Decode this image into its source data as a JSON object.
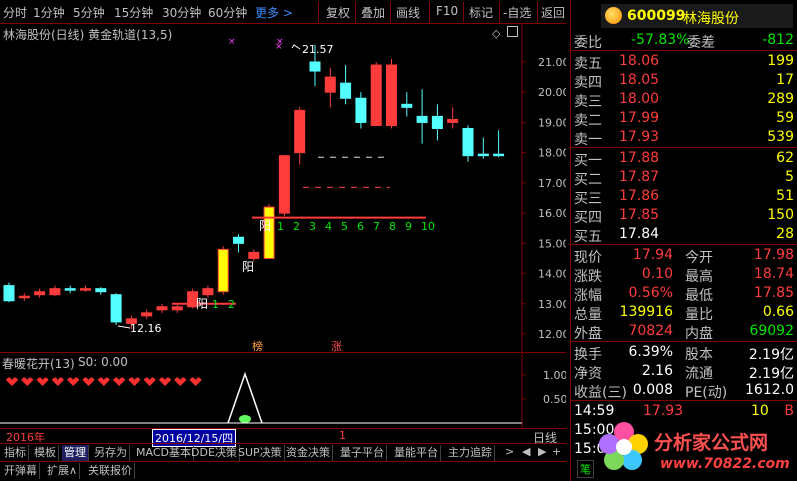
{
  "toolbar": {
    "items": [
      "分时",
      "1分钟",
      "5分钟",
      "15分钟",
      "30分钟",
      "60分钟"
    ],
    "more": "更多 >",
    "buttons": [
      "复权",
      "叠加",
      "画线",
      "F10",
      "标记",
      "-自选",
      "返回"
    ]
  },
  "chart": {
    "title": "林海股份(日线) 黄金轨道(13,5)",
    "price_ticks": [
      "21.00",
      "20.00",
      "19.00",
      "18.00",
      "17.00",
      "16.00",
      "15.00",
      "14.00",
      "13.00",
      "12.00"
    ],
    "high_label": "21.57",
    "low_label": "12.16",
    "yang_labels": [
      "阳",
      "阳",
      "阳"
    ],
    "counter_1": [
      "1",
      "2"
    ],
    "counter_2": [
      "1",
      "2",
      "3",
      "4",
      "5",
      "6",
      "7",
      "8",
      "9",
      "10"
    ],
    "markers": [
      "榜",
      "涨"
    ],
    "candles": [
      {
        "o": 13.6,
        "c": 13.1,
        "h": 13.7,
        "l": 13.05,
        "up": false
      },
      {
        "o": 13.2,
        "c": 13.25,
        "h": 13.35,
        "l": 13.1,
        "up": true
      },
      {
        "o": 13.3,
        "c": 13.4,
        "h": 13.5,
        "l": 13.2,
        "up": true
      },
      {
        "o": 13.3,
        "c": 13.5,
        "h": 13.6,
        "l": 13.25,
        "up": true
      },
      {
        "o": 13.5,
        "c": 13.45,
        "h": 13.6,
        "l": 13.35,
        "up": false
      },
      {
        "o": 13.5,
        "c": 13.5,
        "h": 13.6,
        "l": 13.4,
        "up": true
      },
      {
        "o": 13.5,
        "c": 13.4,
        "h": 13.55,
        "l": 13.3,
        "up": false
      },
      {
        "o": 13.3,
        "c": 12.4,
        "h": 13.35,
        "l": 12.3,
        "up": false
      },
      {
        "o": 12.35,
        "c": 12.5,
        "h": 12.6,
        "l": 12.16,
        "up": true
      },
      {
        "o": 12.6,
        "c": 12.7,
        "h": 12.8,
        "l": 12.5,
        "up": true
      },
      {
        "o": 12.8,
        "c": 12.9,
        "h": 13.0,
        "l": 12.7,
        "up": true
      },
      {
        "o": 12.8,
        "c": 12.9,
        "h": 13.0,
        "l": 12.7,
        "up": true
      },
      {
        "o": 12.9,
        "c": 13.4,
        "h": 13.5,
        "l": 12.85,
        "up": true
      },
      {
        "o": 13.3,
        "c": 13.5,
        "h": 13.6,
        "l": 13.2,
        "up": true
      },
      {
        "o": 13.4,
        "c": 14.8,
        "h": 14.9,
        "l": 13.3,
        "up": true,
        "yellow": true
      },
      {
        "o": 15.0,
        "c": 15.2,
        "h": 15.3,
        "l": 14.7,
        "up": false
      },
      {
        "o": 14.5,
        "c": 14.7,
        "h": 14.8,
        "l": 14.4,
        "up": true
      },
      {
        "o": 14.5,
        "c": 16.2,
        "h": 16.3,
        "l": 14.5,
        "up": true,
        "yellow": true
      },
      {
        "o": 16.0,
        "c": 17.9,
        "h": 17.9,
        "l": 15.9,
        "up": true
      },
      {
        "o": 18.0,
        "c": 19.4,
        "h": 19.5,
        "l": 17.6,
        "up": true
      },
      {
        "o": 20.7,
        "c": 21.0,
        "h": 21.57,
        "l": 20.2,
        "up": false
      },
      {
        "o": 20.0,
        "c": 20.5,
        "h": 20.8,
        "l": 19.5,
        "up": true
      },
      {
        "o": 20.3,
        "c": 19.8,
        "h": 20.9,
        "l": 19.6,
        "up": false
      },
      {
        "o": 19.0,
        "c": 19.8,
        "h": 20.0,
        "l": 18.8,
        "up": false
      },
      {
        "o": 18.9,
        "c": 20.9,
        "h": 21.0,
        "l": 18.9,
        "up": true
      },
      {
        "o": 20.9,
        "c": 18.9,
        "h": 21.1,
        "l": 18.8,
        "up": true
      },
      {
        "o": 19.5,
        "c": 19.6,
        "h": 20.0,
        "l": 19.2,
        "up": false
      },
      {
        "o": 19.2,
        "c": 19.0,
        "h": 20.1,
        "l": 18.3,
        "up": false
      },
      {
        "o": 18.8,
        "c": 19.2,
        "h": 19.6,
        "l": 18.4,
        "up": false
      },
      {
        "o": 19.0,
        "c": 19.1,
        "h": 19.5,
        "l": 18.8,
        "up": true
      },
      {
        "o": 18.8,
        "c": 17.9,
        "h": 18.9,
        "l": 17.7,
        "up": false
      },
      {
        "o": 17.9,
        "c": 17.95,
        "h": 18.5,
        "l": 17.8,
        "up": false
      },
      {
        "o": 17.95,
        "c": 17.93,
        "h": 18.74,
        "l": 17.85,
        "up": false
      }
    ]
  },
  "indicator": {
    "title": "春暖花开(13)",
    "s0": "S0: 0.00",
    "ticks": [
      "1.00",
      "0.50"
    ]
  },
  "datebar": {
    "year": "2016年",
    "date": "2016/12/15/四",
    "one": "1",
    "period": "日线"
  },
  "tabs1": [
    "指标",
    "模板",
    "管理",
    "另存为",
    "MACD基本",
    "DDE决策",
    "SUP决策",
    "资金决策",
    "量子平台",
    "量能平台",
    "主力追踪"
  ],
  "tabs2": [
    "开弹幕",
    "扩展∧",
    "关联报价"
  ],
  "quote": {
    "code": "600099",
    "name": "林海股份",
    "weibi_label": "委比",
    "weibi": "-57.83%",
    "weicha_label": "委差",
    "weicha": "-812",
    "sell": [
      {
        "label": "卖五",
        "price": "18.06",
        "vol": "199"
      },
      {
        "label": "卖四",
        "price": "18.05",
        "vol": "17"
      },
      {
        "label": "卖三",
        "price": "18.00",
        "vol": "289"
      },
      {
        "label": "卖二",
        "price": "17.99",
        "vol": "59"
      },
      {
        "label": "卖一",
        "price": "17.93",
        "vol": "539"
      }
    ],
    "buy": [
      {
        "label": "买一",
        "price": "17.88",
        "vol": "62"
      },
      {
        "label": "买二",
        "price": "17.87",
        "vol": "5"
      },
      {
        "label": "买三",
        "price": "17.86",
        "vol": "51"
      },
      {
        "label": "买四",
        "price": "17.85",
        "vol": "150"
      },
      {
        "label": "买五",
        "price": "17.84",
        "vol": "28"
      }
    ],
    "stats": [
      {
        "l1": "现价",
        "v1": "17.94",
        "l2": "今开",
        "v2": "17.98"
      },
      {
        "l1": "涨跌",
        "v1": "0.10",
        "l2": "最高",
        "v2": "18.74"
      },
      {
        "l1": "涨幅",
        "v1": "0.56%",
        "l2": "最低",
        "v2": "17.85"
      },
      {
        "l1": "总量",
        "v1": "139916",
        "l2": "量比",
        "v2": "0.66"
      },
      {
        "l1": "外盘",
        "v1": "70824",
        "l2": "内盘",
        "v2": "69092"
      }
    ],
    "fin": [
      {
        "l1": "换手",
        "v1": "6.39%",
        "l2": "股本",
        "v2": "2.19亿"
      },
      {
        "l1": "净资",
        "v1": "2.16",
        "l2": "流通",
        "v2": "2.19亿"
      },
      {
        "l1": "收益(三)",
        "v1": "0.008",
        "l2": "PE(动)",
        "v2": "1612.0"
      }
    ],
    "ticks": [
      {
        "time": "14:59",
        "price": "17.93",
        "vol": "10",
        "flag": "B"
      },
      {
        "time": "15:00",
        "price": "",
        "vol": "",
        "flag": ""
      },
      {
        "time": "15:00",
        "price": "",
        "vol": "",
        "flag": ""
      }
    ],
    "footer_btn": "笔"
  },
  "watermark": {
    "text": "分析家公式网",
    "url": "www.70822.com"
  },
  "colors": {
    "up": "#ff3c3c",
    "down": "#54ffff",
    "yellow": "#ffff00",
    "frame": "#800000"
  }
}
